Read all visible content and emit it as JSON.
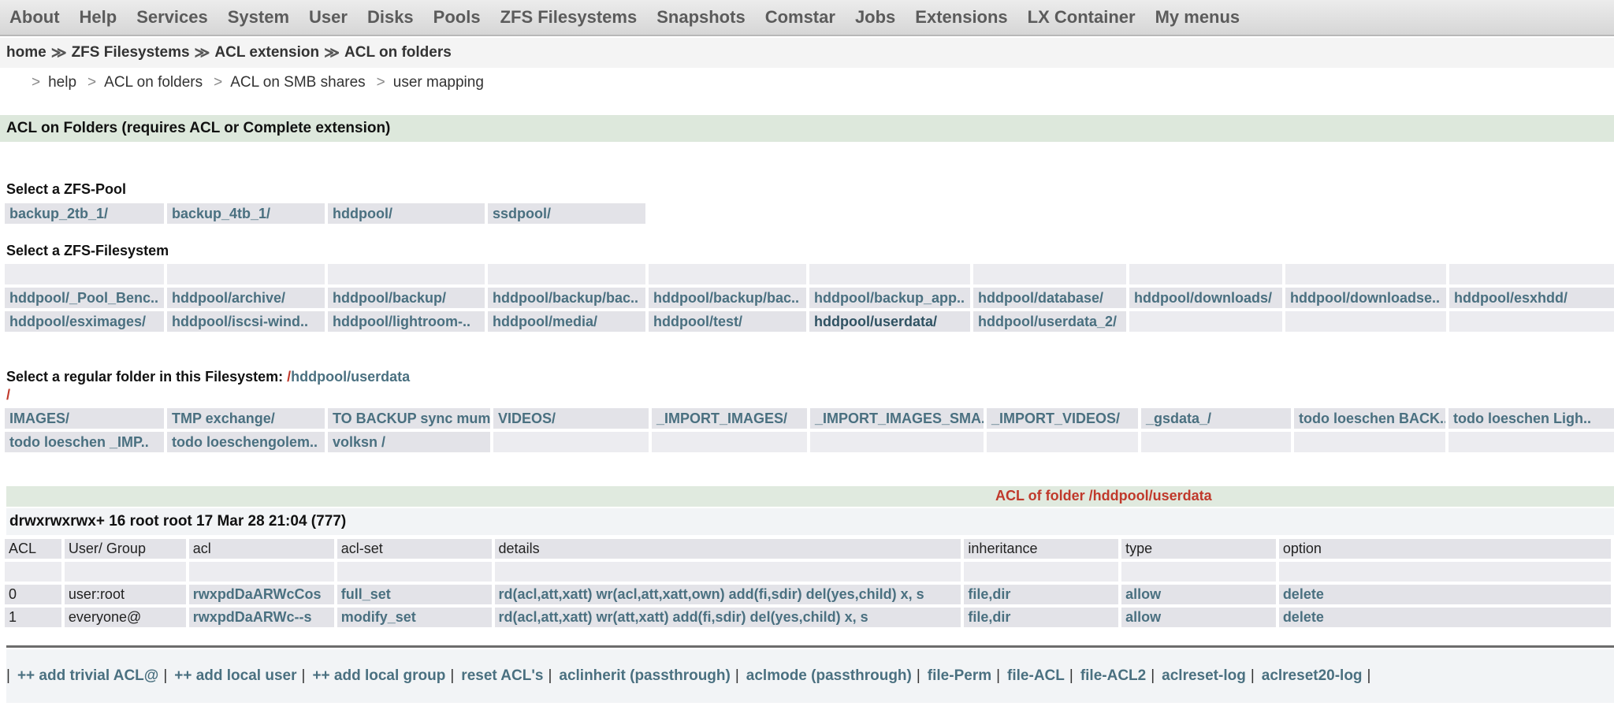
{
  "menu": [
    "About",
    "Help",
    "Services",
    "System",
    "User",
    "Disks",
    "Pools",
    "ZFS Filesystems",
    "Snapshots",
    "Comstar",
    "Jobs",
    "Extensions",
    "LX Container",
    "My menus"
  ],
  "breadcrumb": [
    "home",
    "ZFS Filesystems",
    "ACL extension",
    "ACL on folders"
  ],
  "breadcrumb_sep": "≫",
  "subnav_sep": ">",
  "subnav": [
    "help",
    "ACL on folders",
    "ACL on SMB shares",
    "user mapping"
  ],
  "section_title": "ACL on Folders (requires ACL or Complete extension)",
  "pool_label": "Select a ZFS-Pool",
  "pools": [
    "backup_2tb_1/",
    "backup_4tb_1/",
    "hddpool/",
    "ssdpool/"
  ],
  "fs_label": "Select a ZFS-Filesystem",
  "filesystems": [
    [
      "hddpool/_Pool_Benc..",
      "hddpool/archive/",
      "hddpool/backup/",
      "hddpool/backup/bac..",
      "hddpool/backup/bac..",
      "hddpool/backup_app..",
      "hddpool/database/",
      "hddpool/downloads/",
      "hddpool/downloadse..",
      "hddpool/esxhdd/"
    ],
    [
      "hddpool/esximages/",
      "hddpool/iscsi-wind..",
      "hddpool/lightroom-..",
      "hddpool/media/",
      "hddpool/test/",
      "hddpool/userdata/",
      "hddpool/userdata_2/",
      "",
      "",
      ""
    ]
  ],
  "folder_label": "Select a regular folder in this Filesystem:",
  "folder_path_prefix": "/",
  "folder_path": "hddpool/userdata",
  "folder_path_root": "/",
  "folders": [
    [
      "IMAGES/",
      "TMP exchange/",
      "TO BACKUP sync mum..",
      "VIDEOS/",
      "_IMPORT_IMAGES/",
      "_IMPORT_IMAGES_SMA..",
      "_IMPORT_VIDEOS/",
      "_gsdata_/",
      "todo loeschen BACK..",
      "todo loeschen Ligh.."
    ],
    [
      "todo loeschen _IMP..",
      "todo loeschengolem..",
      "volksn /",
      "",
      "",
      "",
      "",
      "",
      "",
      ""
    ]
  ],
  "acl_title": "ACL of folder /hddpool/userdata",
  "perm_line": "drwxrwxrwx+ 16 root root 17 Mar 28 21:04 (777)",
  "acl_headers": [
    "ACL",
    "User/ Group",
    "acl",
    "acl-set",
    "details",
    "inheritance",
    "type",
    "option"
  ],
  "acl_rows": [
    [
      "0",
      "user:root",
      "rwxpdDaARWcCos",
      "full_set",
      "rd(acl,att,xatt) wr(acl,att,xatt,own) add(fi,sdir) del(yes,child) x, s",
      "file,dir",
      "allow",
      "delete"
    ],
    [
      "1",
      "everyone@",
      "rwxpdDaARWc--s",
      "modify_set",
      "rd(acl,att,xatt) wr(att,xatt) add(fi,sdir) del(yes,child) x, s",
      "file,dir",
      "allow",
      "delete"
    ]
  ],
  "actions": [
    "++ add trivial ACL@",
    "++ add local user",
    "++ add local group",
    "reset ACL's",
    "aclinherit (passthrough)",
    "aclmode (passthrough)",
    "file-Perm",
    "file-ACL",
    "file-ACL2",
    "aclreset-log",
    "aclreset20-log"
  ],
  "actions_sep": "|"
}
